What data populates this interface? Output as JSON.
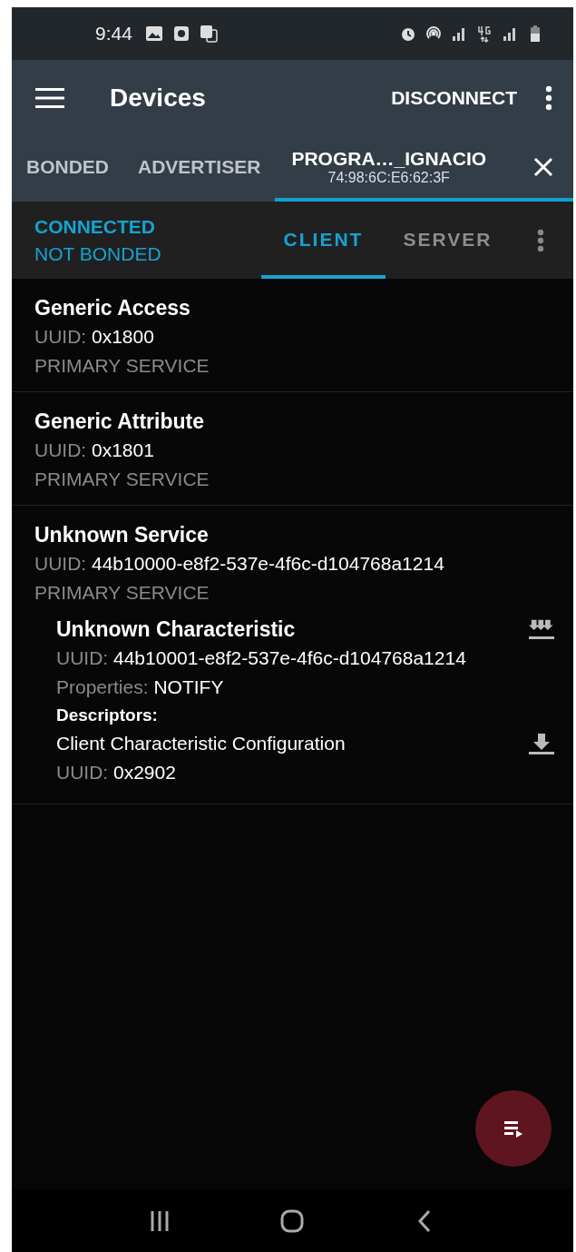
{
  "status_bar": {
    "time": "9:44"
  },
  "app_bar": {
    "title": "Devices",
    "action": "DISCONNECT"
  },
  "tabs": [
    {
      "label": "BONDED",
      "selected": false
    },
    {
      "label": "ADVERTISER",
      "selected": false
    },
    {
      "label": "PROGRA…_IGNACIO",
      "subtitle": "74:98:6C:E6:62:3F",
      "selected": true
    }
  ],
  "connection": {
    "state": "CONNECTED",
    "bond": "NOT BONDED"
  },
  "sub_tabs": [
    {
      "label": "CLIENT",
      "selected": true
    },
    {
      "label": "SERVER",
      "selected": false
    }
  ],
  "services": [
    {
      "name": "Generic Access",
      "uuid_label": "UUID:",
      "uuid": "0x1800",
      "type": "PRIMARY SERVICE"
    },
    {
      "name": "Generic Attribute",
      "uuid_label": "UUID:",
      "uuid": "0x1801",
      "type": "PRIMARY SERVICE"
    },
    {
      "name": "Unknown Service",
      "uuid_label": "UUID:",
      "uuid": "44b10000-e8f2-537e-4f6c-d104768a1214",
      "type": "PRIMARY SERVICE",
      "characteristics": [
        {
          "name": "Unknown Characteristic",
          "uuid_label": "UUID:",
          "uuid": "44b10001-e8f2-537e-4f6c-d104768a1214",
          "properties_label": "Properties:",
          "properties": "NOTIFY",
          "descriptors_label": "Descriptors:",
          "descriptors": [
            {
              "name": "Client Characteristic Configuration",
              "uuid_label": "UUID:",
              "uuid": "0x2902"
            }
          ]
        }
      ]
    }
  ]
}
